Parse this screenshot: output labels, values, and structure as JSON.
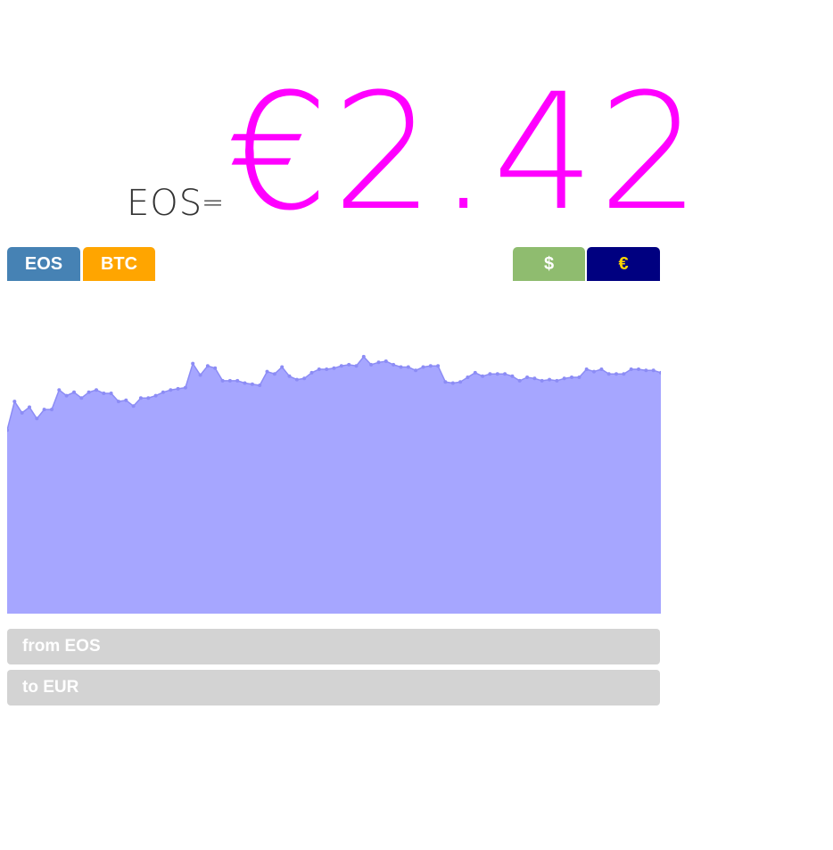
{
  "header": {
    "pair_label": "EOS",
    "equals": "=",
    "price": "€2.42"
  },
  "crypto_tabs": [
    {
      "label": "EOS",
      "color": "#4682b4"
    },
    {
      "label": "BTC",
      "color": "#ffa500"
    }
  ],
  "currency_tabs": [
    {
      "label": "$",
      "color": "#8fbc6f"
    },
    {
      "label": "€",
      "color": "#000080",
      "text_color": "#ffd700"
    }
  ],
  "fields": {
    "from": "from EOS",
    "to": "to EUR"
  },
  "chart_data": {
    "type": "area",
    "title": "",
    "xlabel": "",
    "ylabel": "",
    "grid": false,
    "fill_color": "#a6a6ff",
    "line_color": "#8c8cf5",
    "ylim": [
      0,
      2.9
    ],
    "values": [
      1.6,
      1.85,
      1.75,
      1.8,
      1.7,
      1.78,
      1.78,
      1.95,
      1.9,
      1.93,
      1.88,
      1.93,
      1.95,
      1.92,
      1.92,
      1.85,
      1.86,
      1.81,
      1.88,
      1.88,
      1.9,
      1.93,
      1.95,
      1.96,
      1.97,
      2.18,
      2.08,
      2.16,
      2.14,
      2.03,
      2.03,
      2.03,
      2.01,
      2.0,
      1.99,
      2.11,
      2.09,
      2.15,
      2.07,
      2.04,
      2.05,
      2.1,
      2.13,
      2.13,
      2.14,
      2.16,
      2.17,
      2.16,
      2.24,
      2.17,
      2.19,
      2.2,
      2.17,
      2.15,
      2.15,
      2.12,
      2.15,
      2.16,
      2.16,
      2.02,
      2.01,
      2.02,
      2.06,
      2.1,
      2.07,
      2.09,
      2.09,
      2.09,
      2.07,
      2.03,
      2.06,
      2.05,
      2.03,
      2.04,
      2.03,
      2.05,
      2.06,
      2.06,
      2.13,
      2.11,
      2.13,
      2.09,
      2.09,
      2.09,
      2.13,
      2.13,
      2.12,
      2.12,
      2.1
    ]
  }
}
